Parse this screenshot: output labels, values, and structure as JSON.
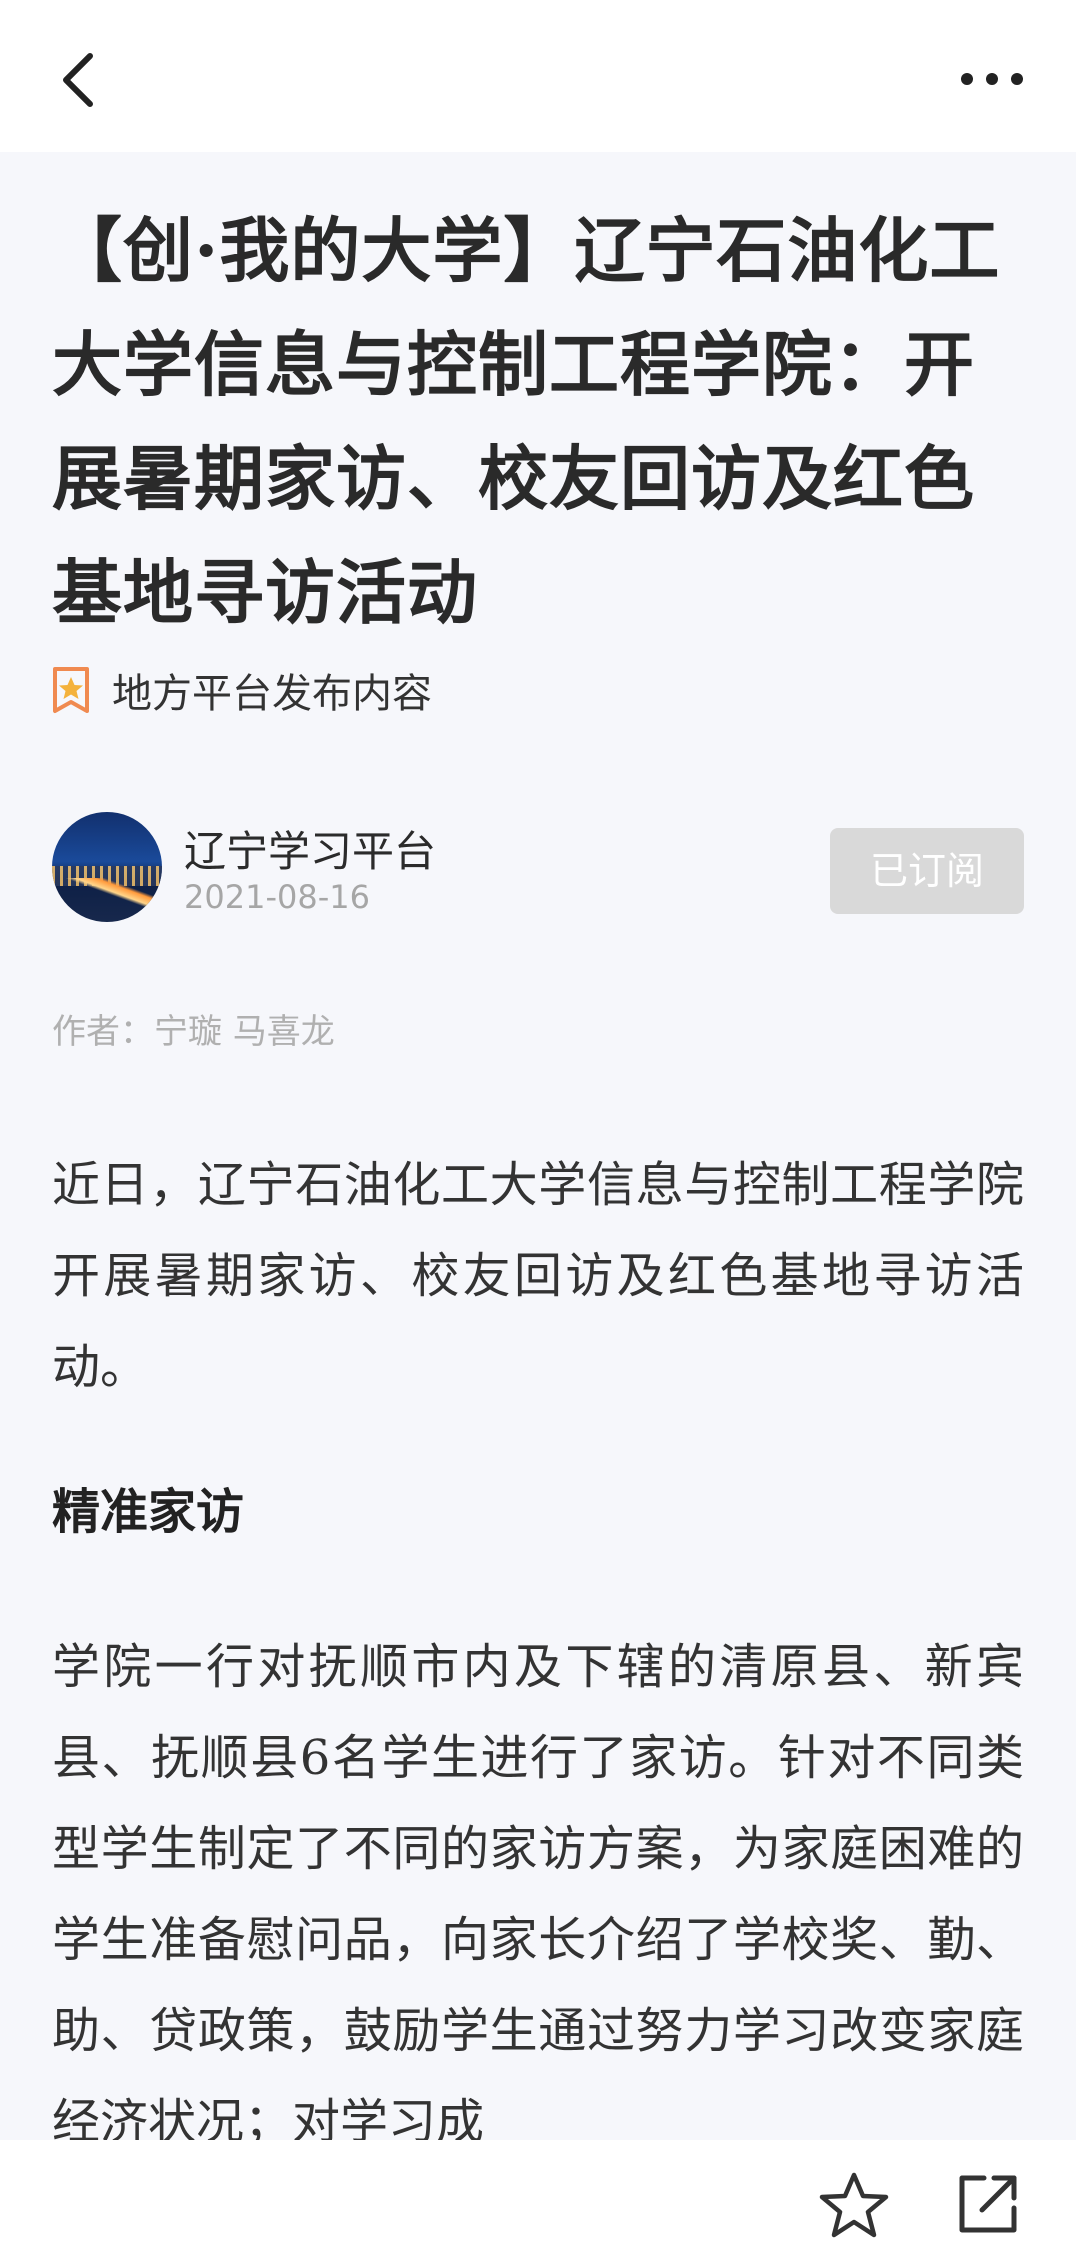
{
  "topbar": {
    "back_icon": "chevron-left-icon",
    "more_icon": "more-horizontal-icon"
  },
  "article": {
    "title": "【创·我的大学】辽宁石油化工大学信息与控制工程学院：开展暑期家访、校友回访及红色基地寻访活动",
    "source_label": "地方平台发布内容",
    "source_icon": "star-badge-icon",
    "publisher": {
      "name": "辽宁学习平台",
      "date": "2021-08-16",
      "subscribe_label": "已订阅"
    },
    "author_line": "作者：宁璇 马喜龙",
    "paragraph_1": "近日，辽宁石油化工大学信息与控制工程学院开展暑期家访、校友回访及红色基地寻访活动。",
    "section_heading": "精准家访",
    "paragraph_2": "学院一行对抚顺市内及下辖的清原县、新宾县、抚顺县6名学生进行了家访。针对不同类型学生制定了不同的家访方案，为家庭困难的学生准备慰问品，向家长介绍了学校奖、勤、助、贷政策，鼓励学生通过努力学习改变家庭经济状况；对学习成"
  },
  "bottombar": {
    "star_icon": "star-icon",
    "share_icon": "share-external-icon"
  },
  "colors": {
    "source_icon": "#f0a060",
    "subscribe_bg": "#d9d9d9",
    "date": "#a6a6a6"
  }
}
